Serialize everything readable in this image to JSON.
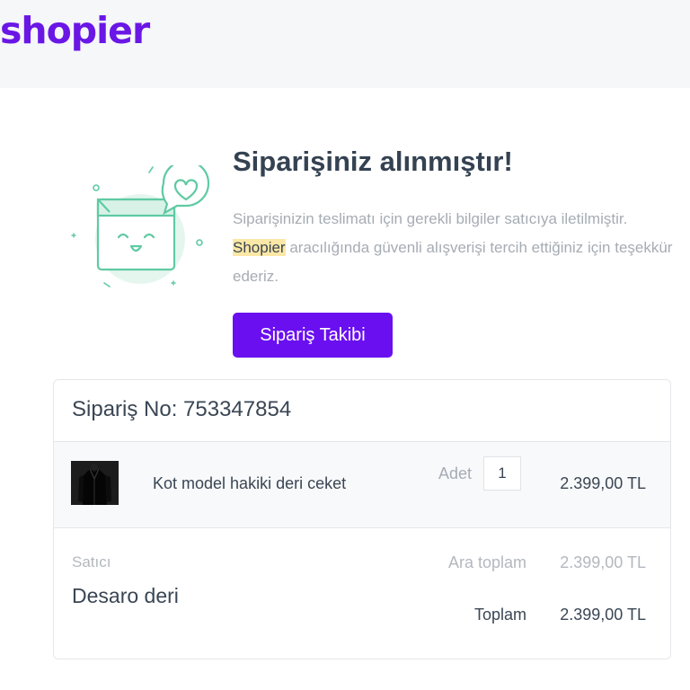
{
  "brand": {
    "logo_text": "shopier",
    "color": "#6a17e6"
  },
  "confirmation": {
    "title": "Siparişiniz alınmıştır!",
    "message_part1": "Siparişinizin teslimatı için gerekli bilgiler satıcıya iletilmiştir. ",
    "message_highlight": "Shopier",
    "message_part2": " aracılığında güvenli alışverişi tercih ettiğiniz için teşekkür ederiz.",
    "illustration_icon": "happy-box-with-heart-speech-bubble-icon",
    "button_label": "Sipariş Takibi",
    "button_color": "#6a10f0"
  },
  "order": {
    "number_label": "Sipariş No: 753347854",
    "item": {
      "image_icon": "black-leather-jacket-thumbnail",
      "name": "Kot model hakiki deri ceket",
      "quantity_label": "Adet",
      "quantity": "1",
      "price": "2.399,00 TL"
    },
    "seller_label": "Satıcı",
    "seller_name": "Desaro deri",
    "subtotal_label": "Ara toplam",
    "subtotal_value": "2.399,00 TL",
    "total_label": "Toplam",
    "total_value": "2.399,00 TL"
  }
}
